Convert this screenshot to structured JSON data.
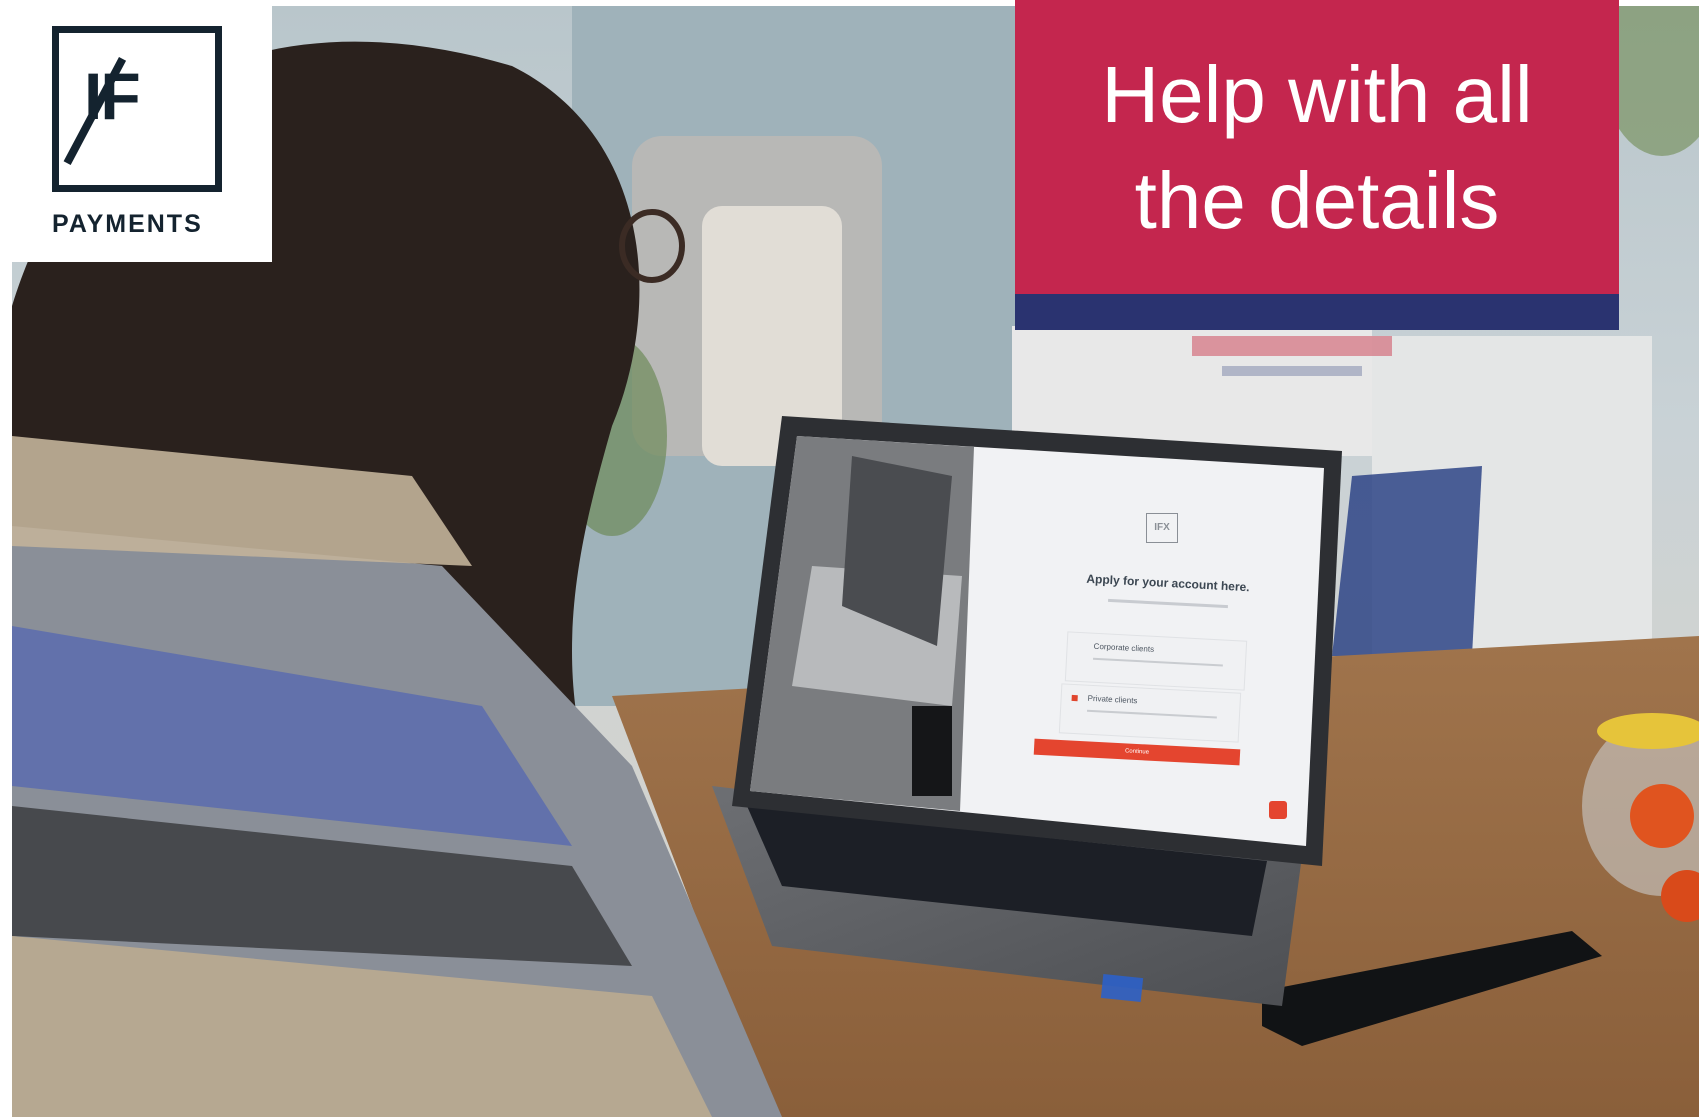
{
  "brand": {
    "logo_mark": "IF",
    "logo_name": "PAYMENTS"
  },
  "headline": {
    "line1": "Help with all",
    "line2": "the details"
  },
  "laptop_screen": {
    "logo": "IFX",
    "title": "Apply for your account here.",
    "option1": "Corporate clients",
    "option2": "Private clients",
    "button": "Continue"
  },
  "colors": {
    "banner": "#c4264e",
    "banner_stripe": "#2a3370",
    "logo_ink": "#14232f",
    "screen_accent": "#e4452f"
  }
}
